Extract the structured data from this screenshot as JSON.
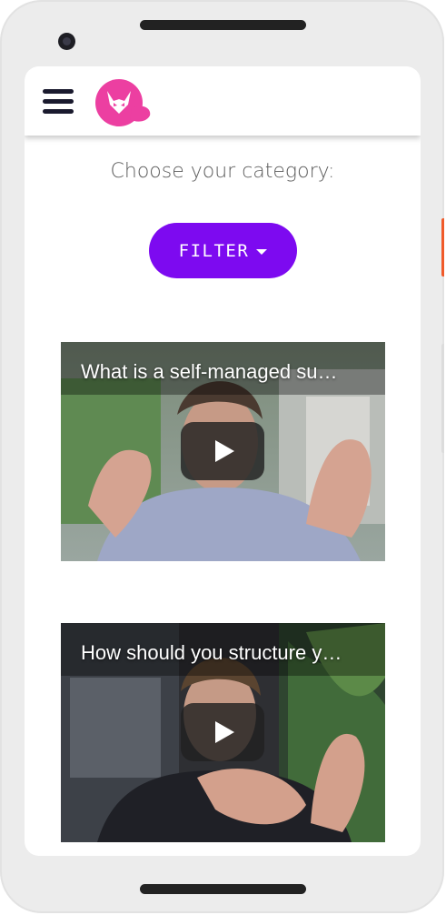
{
  "app": {
    "page_title": "Choose your category:",
    "filter_label": "FILTER"
  },
  "videos": [
    {
      "title": "What is a self-managed su…"
    },
    {
      "title": "How should you structure y…"
    }
  ],
  "colors": {
    "accent": "#7d0af0",
    "logo_pink": "#ec3fa1",
    "phone_body": "#ececec"
  },
  "icons": {
    "menu": "hamburger-menu-icon",
    "logo": "fox-logo",
    "filter_caret": "caret-down-icon",
    "play": "play-icon"
  }
}
